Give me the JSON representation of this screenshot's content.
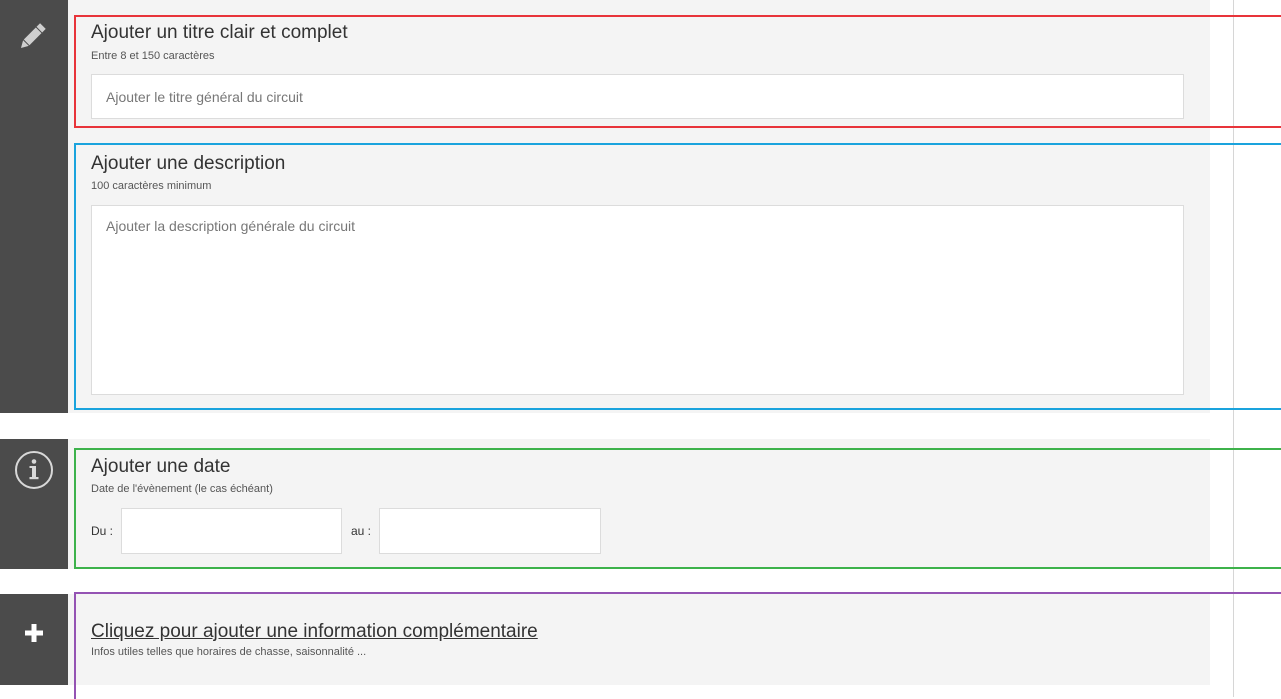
{
  "title_section": {
    "heading": "Ajouter un titre clair et complet",
    "hint": "Entre 8 et 150 caractères",
    "placeholder": "Ajouter le titre général du circuit",
    "icon": "pencil-icon"
  },
  "description_section": {
    "heading": "Ajouter une description",
    "hint": "100 caractères minimum",
    "placeholder": "Ajouter la description générale du circuit"
  },
  "date_section": {
    "heading": "Ajouter une date",
    "hint": "Date de l'évènement (le cas échéant)",
    "from_label": "Du :",
    "to_label": "au :",
    "icon": "info-icon"
  },
  "extra_section": {
    "link": "Cliquez pour ajouter une information complémentaire",
    "hint": "Infos utiles telles que horaires de chasse, saisonnalité ...",
    "icon": "plus-icon"
  },
  "colors": {
    "red_outline": "#e8343a",
    "blue_outline": "#1aa3dd",
    "green_outline": "#3db24b",
    "purple_outline": "#9453b3",
    "sidebar": "#4b4b4b",
    "panel": "#f4f4f4"
  }
}
